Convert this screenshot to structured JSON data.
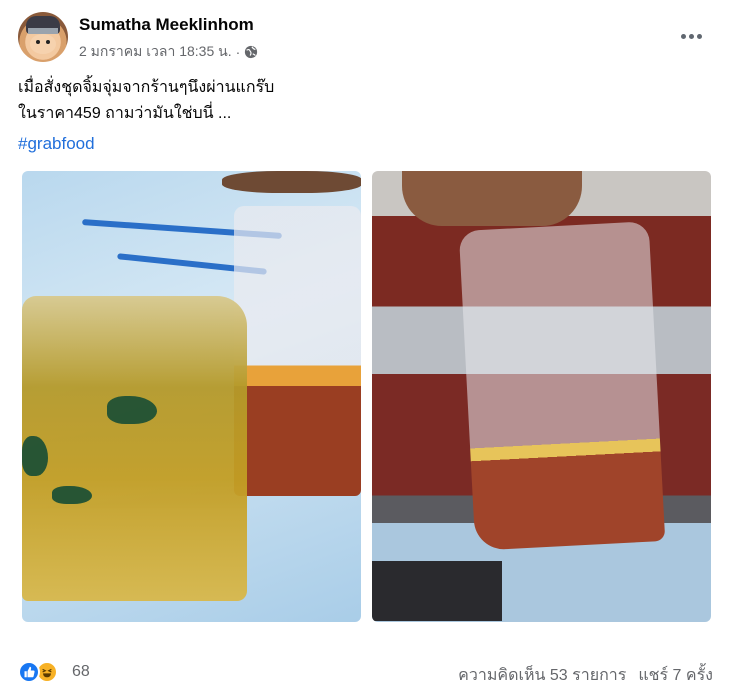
{
  "post": {
    "author": "Sumatha Meeklinhom",
    "timestamp": "2 มกราคม เวลา 18:35 น.",
    "separator": "·",
    "privacy_icon": "globe-icon",
    "more_icon": "more-horizontal-icon",
    "text_line1": "เมื่อสั่งชุดจิ้มจุ่มจากร้านๆนึงผ่านแกร๊บ",
    "text_line2": "ในราคา459 ถามว่ามันใช่บนี่ ...",
    "hashtag": "#grabfood"
  },
  "footer": {
    "reaction_icons": [
      "like-icon",
      "haha-icon"
    ],
    "reaction_count": "68",
    "comments": "ความคิดเห็น 53 รายการ",
    "shares": "แชร์ 7 ครั้ง"
  },
  "colors": {
    "hashtag": "#216fdb",
    "like": "#1877f2",
    "haha": "#f7b125",
    "meta_text": "#65676b"
  }
}
